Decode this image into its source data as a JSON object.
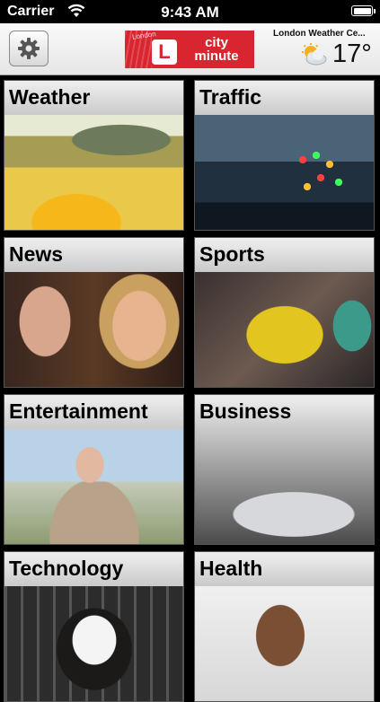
{
  "status_bar": {
    "carrier": "Carrier",
    "time": "9:43 AM"
  },
  "header": {
    "settings_icon": "gear-icon",
    "logo": {
      "place": "London",
      "badge": "L",
      "line1": "city",
      "line2": "minute"
    },
    "weather": {
      "label": "London Weather Ce...",
      "icon": "partly-cloudy-icon",
      "temperature": "17°"
    }
  },
  "tiles": [
    {
      "label": "Weather"
    },
    {
      "label": "Traffic"
    },
    {
      "label": "News"
    },
    {
      "label": "Sports"
    },
    {
      "label": "Entertainment"
    },
    {
      "label": "Business"
    },
    {
      "label": "Technology"
    },
    {
      "label": "Health"
    }
  ]
}
